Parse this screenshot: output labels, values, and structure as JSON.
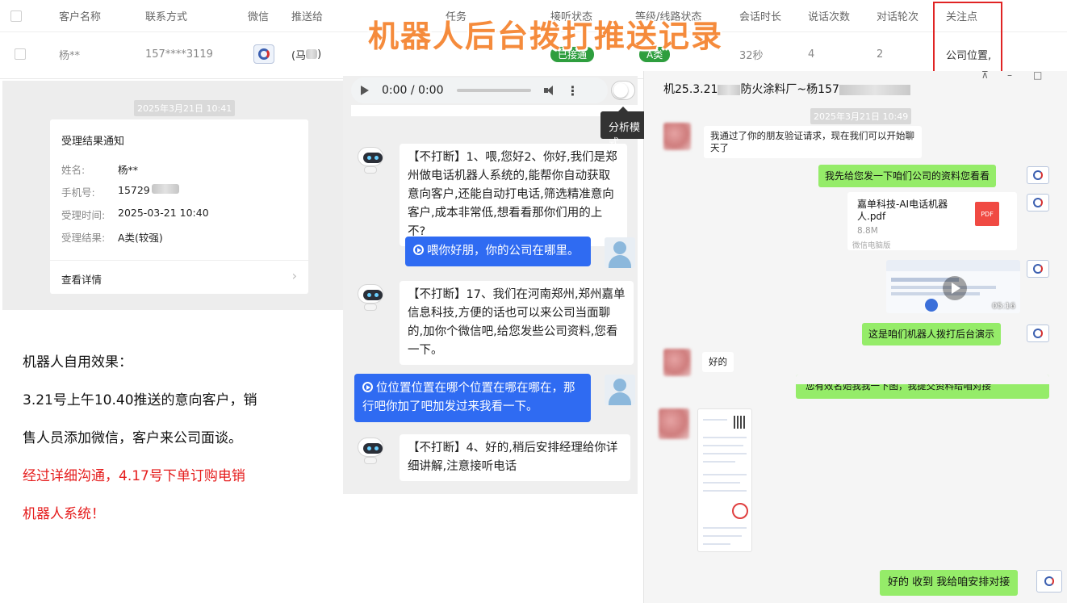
{
  "banner": "机器人后台拨打推送记录",
  "table": {
    "headers": [
      "客户名称",
      "联系方式",
      "微信",
      "推送给",
      "任务",
      "接听状态",
      "等级/线路状态",
      "会话时长",
      "说话次数",
      "对话轮次",
      "关注点"
    ],
    "row": {
      "name": "杨**",
      "phone": "157****3119",
      "push_to": "(马",
      "push_to_tail": ")",
      "answer_status": "已接通",
      "level": "A类",
      "duration": "32秒",
      "speak_count": "4",
      "rounds": "2",
      "focus": "公司位置,"
    }
  },
  "notification": {
    "timestamp": "2025年3月21日 10:41",
    "title": "受理结果通知",
    "fields": [
      {
        "k": "姓名:",
        "v": "杨**"
      },
      {
        "k": "手机号:",
        "v": "15729"
      },
      {
        "k": "受理时间:",
        "v": "2025-03-21 10:40"
      },
      {
        "k": "受理结果:",
        "v": "A类(较强)"
      }
    ],
    "link": "查看详情"
  },
  "effect": {
    "title": "机器人自用效果：",
    "line1": "3.21号上午10.40推送的意向客户，销",
    "line2": "售人员添加微信，客户来公司面谈。",
    "line3": "经过详细沟通，4.17号下单订购电销",
    "line4": "机器人系统！"
  },
  "call": {
    "audio_time": "0:00 / 0:00",
    "tooltip": "分析模式",
    "messages": [
      {
        "role": "robot",
        "text": "【不打断】1、喂,您好2、你好,我们是郑州做电话机器人系统的,能帮你自动获取意向客户,还能自动打电话,筛选精准意向客户,成本非常低,想看看那你们用的上不?"
      },
      {
        "role": "user",
        "text": "喂你好朋，你的公司在哪里。"
      },
      {
        "role": "robot",
        "text": "【不打断】17、我们在河南郑州,郑州嘉单信息科技,方便的话也可以来公司当面聊的,加你个微信吧,给您发些公司资料,您看一下。"
      },
      {
        "role": "user",
        "text": "位位置位置在哪个位置在哪在哪在，那行吧你加了吧加发过来我看一下。"
      },
      {
        "role": "robot",
        "text": "【不打断】4、好的,稍后安排经理给你详细讲解,注意接听电话"
      }
    ]
  },
  "wechat": {
    "title": "机25.3.21",
    "title_mid": "防火涂料厂~杨157",
    "window_controls": {
      "pin": "⊼",
      "minimize": "–",
      "maximize": "□"
    },
    "timestamp": "2025年3月21日 10:49",
    "msg_in_1": "我通过了你的朋友验证请求，现在我们可以开始聊天了",
    "msg_out_1": "我先给您发一下咱们公司的资料您看看",
    "file_name": "嘉单科技-AI电话机器人.pdf",
    "file_size": "8.8M",
    "file_source": "微信电脑版",
    "pdf_label": "PDF",
    "video_duration": "05:16",
    "msg_out_2": "这是咱们机器人拨打后台演示",
    "msg_in_2": "好的",
    "msg_out_overlay": "您有效名始我我一下图，我提交资料给咱对接",
    "msg_out_3": "好的 收到 我给咱安排对接"
  }
}
